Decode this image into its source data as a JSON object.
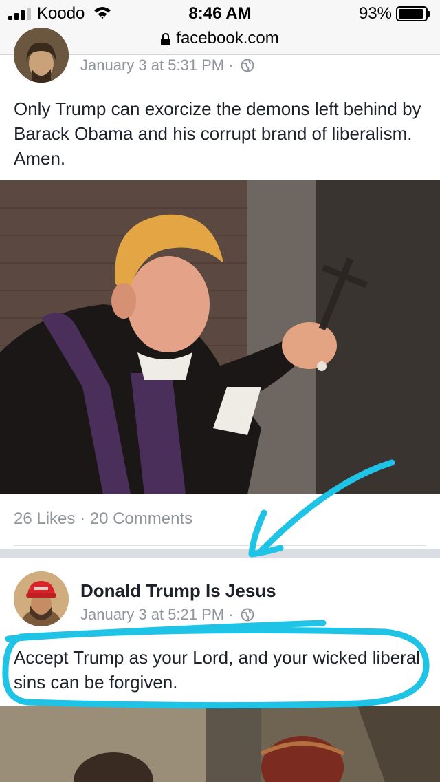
{
  "status_bar": {
    "carrier": "Koodo",
    "time": "8:46 AM",
    "battery": "93%",
    "battery_level": 0.93
  },
  "browser": {
    "url": "facebook.com"
  },
  "posts": [
    {
      "time": "January 3 at 5:31 PM",
      "separator": "·",
      "text": "Only Trump can exorcize the demons left behind by Barack Obama and his corrupt brand of liberalism. Amen.",
      "likes": "26 Likes",
      "comments": "20 Comments"
    },
    {
      "author": "Donald Trump Is Jesus",
      "time": "January 3 at 5:21 PM",
      "separator": "·",
      "text": "Accept Trump as your Lord, and your wicked liberal sins can be forgiven."
    }
  ],
  "annotation_color": "#1fc3e6"
}
